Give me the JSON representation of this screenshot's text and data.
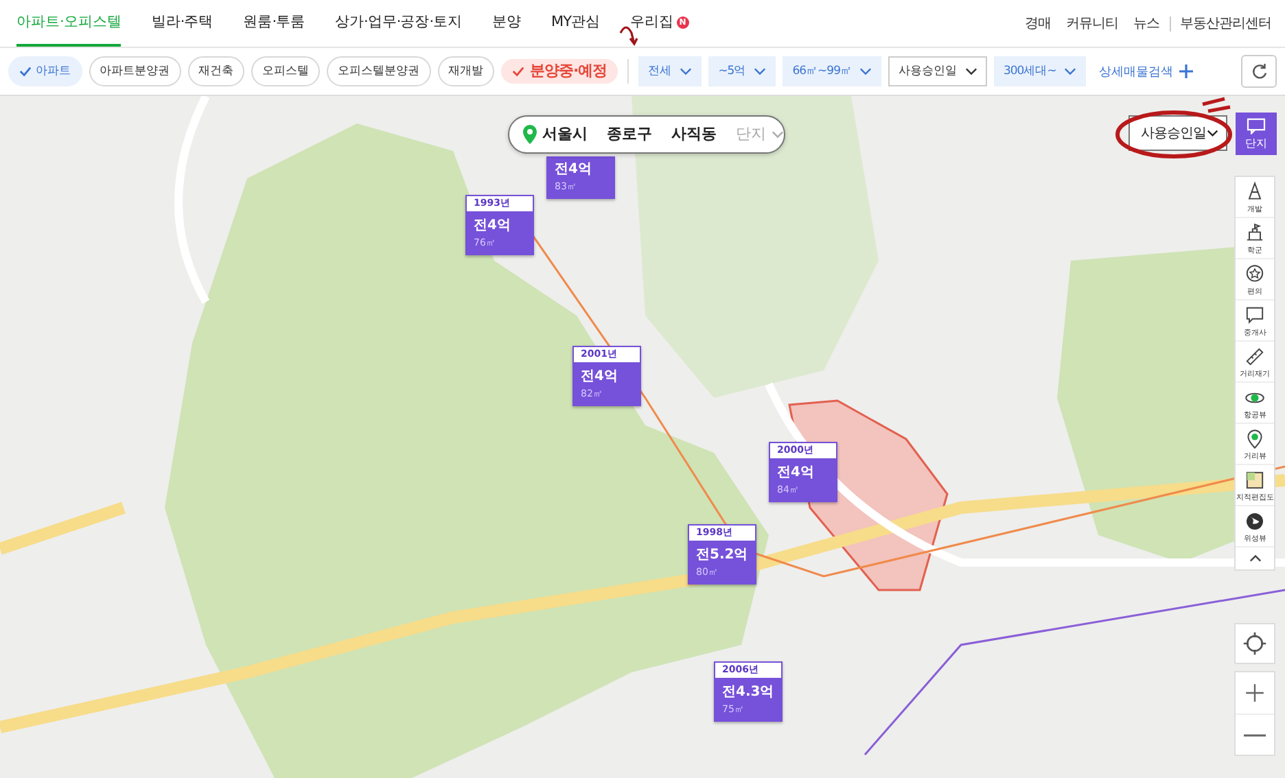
{
  "top_nav": {
    "items": [
      {
        "label": "아파트·오피스텔",
        "selected": true
      },
      {
        "label": "빌라·주택",
        "selected": false
      },
      {
        "label": "원룸·투룸",
        "selected": false
      },
      {
        "label": "상가·업무·공장·토지",
        "selected": false
      },
      {
        "label": "분양",
        "selected": false
      },
      {
        "label": "MY관심",
        "selected": false
      },
      {
        "label": "우리집",
        "selected": false,
        "badge": "N"
      }
    ],
    "links": [
      "경매",
      "커뮤니티",
      "뉴스",
      "부동산관리센터"
    ]
  },
  "filter_bar": {
    "chips": [
      {
        "label": "아파트",
        "selected": true,
        "kind": "blue"
      },
      {
        "label": "아파트분양권",
        "selected": false,
        "kind": "blue"
      },
      {
        "label": "재건축",
        "selected": false,
        "kind": "blue"
      },
      {
        "label": "오피스텔",
        "selected": false,
        "kind": "blue"
      },
      {
        "label": "오피스텔분양권",
        "selected": false,
        "kind": "blue"
      },
      {
        "label": "재개발",
        "selected": false,
        "kind": "blue"
      },
      {
        "label": "분양중·예정",
        "selected": true,
        "kind": "red"
      }
    ],
    "dropdowns": [
      {
        "label": "전세",
        "active": true
      },
      {
        "label": "~5억",
        "active": true
      },
      {
        "label": "66㎡~99㎡",
        "active": true
      },
      {
        "label": "사용승인일",
        "active": false
      },
      {
        "label": "300세대~",
        "active": true
      }
    ],
    "detail_search": "상세매물검색"
  },
  "map": {
    "breadcrumb": [
      {
        "label": "서울시",
        "selected": true
      },
      {
        "label": "종로구",
        "selected": true
      },
      {
        "label": "사직동",
        "selected": true
      },
      {
        "label": "단지",
        "selected": false
      }
    ],
    "markers": [
      {
        "price": "전4억",
        "area": "83㎡"
      },
      {
        "year": "1993년",
        "price": "전4억",
        "area": "76㎡"
      },
      {
        "year": "2001년",
        "price": "전4억",
        "area": "82㎡"
      },
      {
        "year": "2000년",
        "price": "전4억",
        "area": "84㎡"
      },
      {
        "year": "1998년",
        "price": "전5.2억",
        "area": "80㎡"
      },
      {
        "year": "2006년",
        "price": "전4.3억",
        "area": "75㎡"
      }
    ],
    "sort_dropdown": "사용승인일",
    "complex_button": {
      "label": "단지",
      "selected": true
    },
    "tools": [
      {
        "label": "개발"
      },
      {
        "label": "학군"
      },
      {
        "label": "편의"
      },
      {
        "label": "중개사"
      },
      {
        "label": "거리재기"
      },
      {
        "label": "항공뷰"
      },
      {
        "label": "거리뷰"
      },
      {
        "label": "지적편집도"
      },
      {
        "label": "위성뷰"
      }
    ]
  }
}
